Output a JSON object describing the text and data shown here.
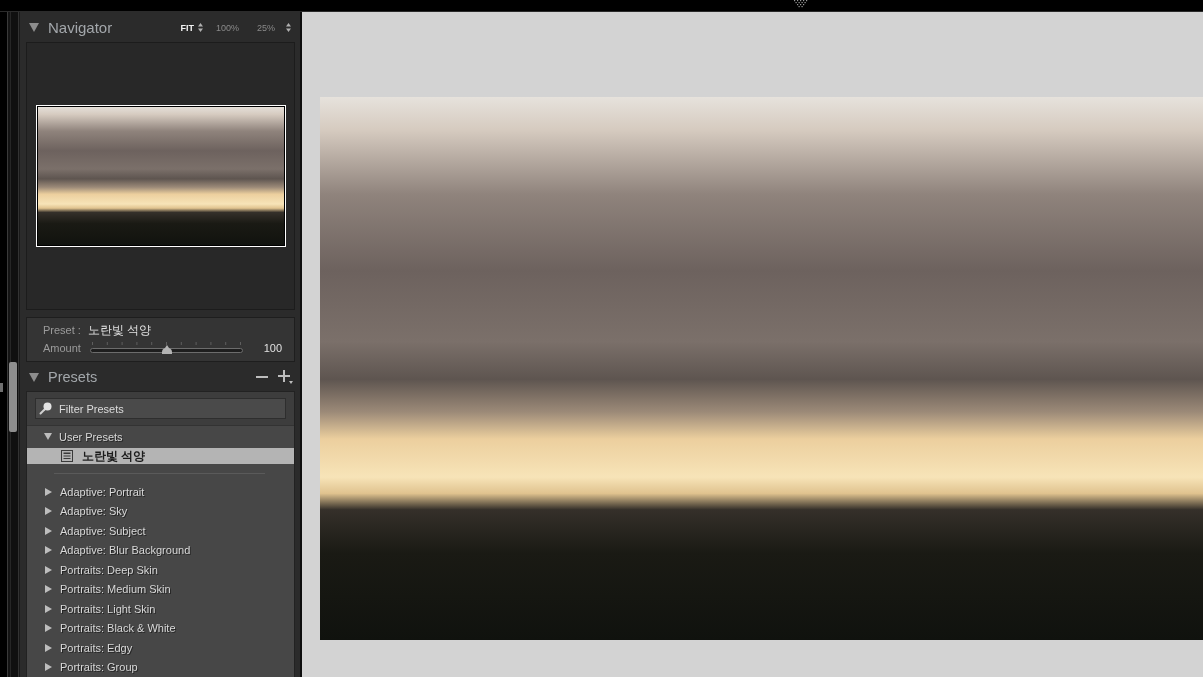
{
  "navigator": {
    "title": "Navigator",
    "expanded": true,
    "zoom_options": [
      {
        "label": "FIT",
        "selected": true,
        "dropdown": true
      },
      {
        "label": "100%",
        "selected": false,
        "dropdown": false
      },
      {
        "label": "25%",
        "selected": false,
        "dropdown": true
      }
    ]
  },
  "preset_amount": {
    "preset_label": "Preset :",
    "preset_name": "노란빛 석양",
    "amount_label": "Amount",
    "level": 0.5,
    "value": "100"
  },
  "presets": {
    "title": "Presets",
    "expanded": true,
    "filter": {
      "placeholder": "Filter Presets"
    },
    "user_presets": {
      "label": "User Presets",
      "expanded": true,
      "items": [
        {
          "label": "노란빛 석양",
          "selected": true
        }
      ]
    },
    "groups": [
      {
        "label": "Adaptive: Portrait",
        "expanded": false
      },
      {
        "label": "Adaptive: Sky",
        "expanded": false
      },
      {
        "label": "Adaptive: Subject",
        "expanded": false
      },
      {
        "label": "Adaptive: Blur Background",
        "expanded": false
      },
      {
        "label": "Portraits: Deep Skin",
        "expanded": false
      },
      {
        "label": "Portraits: Medium Skin",
        "expanded": false
      },
      {
        "label": "Portraits: Light Skin",
        "expanded": false
      },
      {
        "label": "Portraits: Black & White",
        "expanded": false
      },
      {
        "label": "Portraits: Edgy",
        "expanded": false
      },
      {
        "label": "Portraits: Group",
        "expanded": false
      }
    ]
  }
}
